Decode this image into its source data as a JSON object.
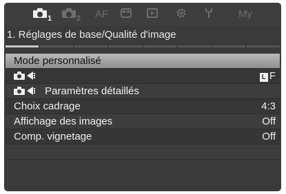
{
  "tabs": [
    {
      "label": "1",
      "kind": "camera",
      "active": true
    },
    {
      "label": "2",
      "kind": "camera",
      "active": false
    },
    {
      "label": "AF",
      "kind": "text",
      "active": false
    },
    {
      "label": "",
      "kind": "video",
      "active": false
    },
    {
      "label": "",
      "kind": "playback",
      "active": false
    },
    {
      "label": "",
      "kind": "gear",
      "active": false
    },
    {
      "label": "",
      "kind": "wrench",
      "active": false
    },
    {
      "label": "My",
      "kind": "text",
      "active": false
    }
  ],
  "header": {
    "title": "1. Réglages de base/Qualité d'image"
  },
  "progress": {
    "pages": 8,
    "current": 1
  },
  "menu": {
    "items": [
      {
        "label": "Mode personnalisé",
        "value": "",
        "selected": true
      },
      {
        "label": "",
        "value": "F",
        "value_badge": "L",
        "icon": "camera-flash"
      },
      {
        "label": "Paramètres détaillés",
        "value": "",
        "icon": "camera-flash"
      },
      {
        "label": "Choix cadrage",
        "value": "4:3"
      },
      {
        "label": "Affichage des images",
        "value": "Off"
      },
      {
        "label": "Comp. vignetage",
        "value": "Off"
      }
    ]
  },
  "colors": {
    "background": "#3a3a3a",
    "highlight": "#a8a8a8",
    "text": "#f0f0f0",
    "inactive_tab": "#6e6e6e"
  }
}
